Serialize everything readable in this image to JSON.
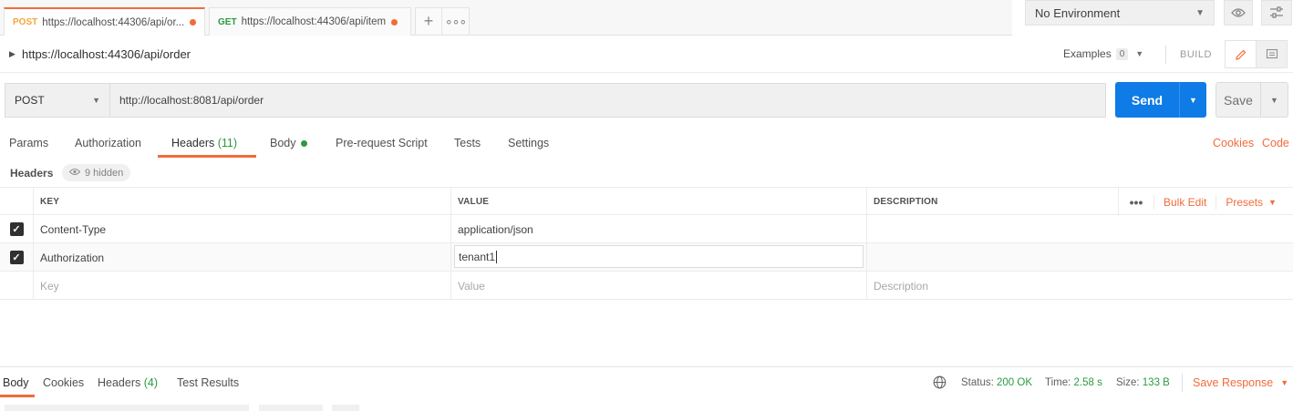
{
  "tabs": [
    {
      "method": "POST",
      "url": "https://localhost:44306/api/or..."
    },
    {
      "method": "GET",
      "url": "https://localhost:44306/api/item"
    }
  ],
  "environment": {
    "selected": "No Environment"
  },
  "request": {
    "title": "https://localhost:44306/api/order",
    "examples_label": "Examples",
    "examples_count": "0",
    "build_label": "BUILD",
    "method": "POST",
    "url": "http://localhost:8081/api/order",
    "send_label": "Send",
    "save_label": "Save"
  },
  "request_tabs": {
    "params": "Params",
    "authorization": "Authorization",
    "headers": "Headers",
    "headers_count": "(11)",
    "body": "Body",
    "prerequest": "Pre-request Script",
    "tests": "Tests",
    "settings": "Settings",
    "cookies": "Cookies",
    "code": "Code"
  },
  "headers_section": {
    "label": "Headers",
    "hidden": "9 hidden",
    "columns": {
      "key": "KEY",
      "value": "VALUE",
      "description": "DESCRIPTION"
    },
    "bulk_edit": "Bulk Edit",
    "presets": "Presets",
    "rows": [
      {
        "checked": true,
        "key": "Content-Type",
        "value": "application/json",
        "description": ""
      },
      {
        "checked": true,
        "key": "Authorization",
        "value": "tenant1",
        "description": ""
      }
    ],
    "placeholder": {
      "key": "Key",
      "value": "Value",
      "description": "Description"
    }
  },
  "response": {
    "tabs": {
      "body": "Body",
      "cookies": "Cookies",
      "headers": "Headers",
      "headers_count": "(4)",
      "test_results": "Test Results"
    },
    "status_label": "Status:",
    "status_value": "200 OK",
    "time_label": "Time:",
    "time_value": "2.58 s",
    "size_label": "Size:",
    "size_value": "133 B",
    "save_response": "Save Response"
  },
  "colors": {
    "accent": "#f26b3a",
    "send": "#0e7be6",
    "ok": "#2a9a3f"
  }
}
